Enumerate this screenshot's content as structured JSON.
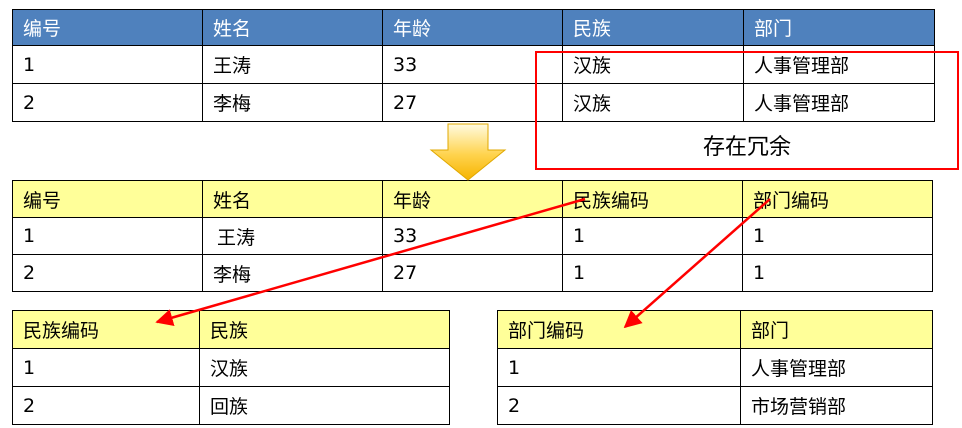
{
  "top_table": {
    "headers": [
      "编号",
      "姓名",
      "年龄",
      "民族",
      "部门"
    ],
    "rows": [
      [
        "1",
        "王涛",
        "33",
        "汉族",
        "人事管理部"
      ],
      [
        "2",
        "李梅",
        "27",
        "汉族",
        "人事管理部"
      ]
    ]
  },
  "annotation": {
    "redundancy": "存在冗余"
  },
  "middle_table": {
    "headers": [
      "编号",
      "姓名",
      "年龄",
      "民族编码",
      "部门编码"
    ],
    "rows": [
      [
        "1",
        "王涛",
        "33",
        "1",
        "1"
      ],
      [
        "2",
        "李梅",
        "27",
        "1",
        "1"
      ]
    ]
  },
  "nation_table": {
    "headers": [
      "民族编码",
      "民族"
    ],
    "rows": [
      [
        "1",
        "汉族"
      ],
      [
        "2",
        "回族"
      ]
    ]
  },
  "dept_table": {
    "headers": [
      "部门编码",
      "部门"
    ],
    "rows": [
      [
        "1",
        "人事管理部"
      ],
      [
        "2",
        "市场营销部"
      ]
    ]
  },
  "colors": {
    "blue_header": "#4f81bd",
    "yellow_header": "#ffff99",
    "red_accent": "#ff0000",
    "down_arrow": "#f6b400"
  }
}
